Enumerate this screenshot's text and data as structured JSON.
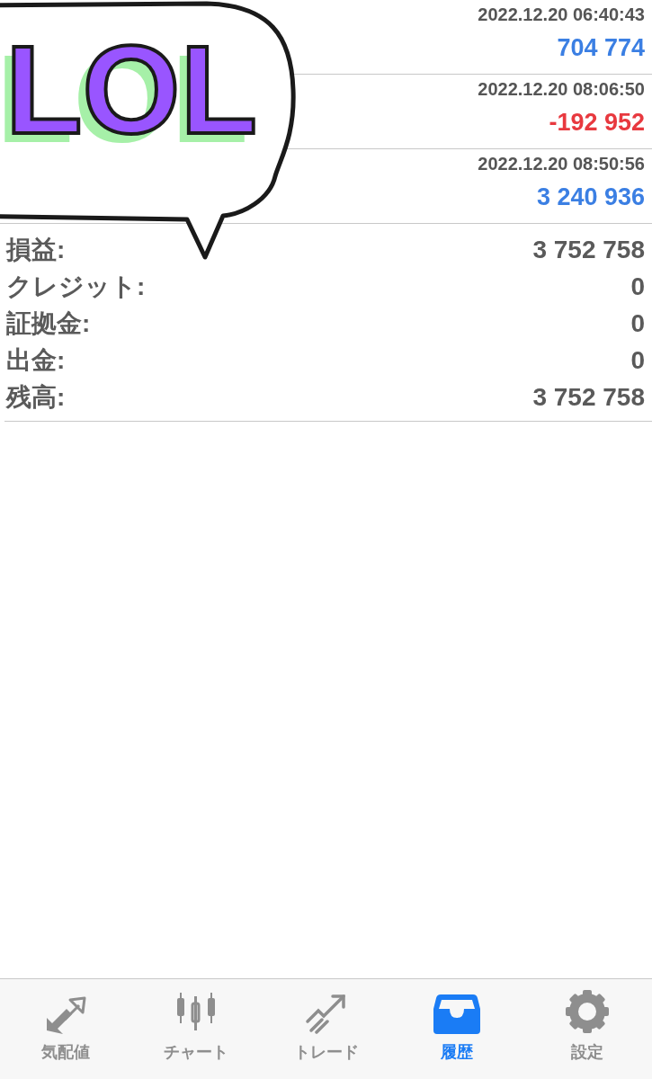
{
  "sticker": {
    "text": "LOL"
  },
  "trades": [
    {
      "time": "2022.12.20 06:40:43",
      "profit": "704 774",
      "kind": "gain"
    },
    {
      "time": "2022.12.20 08:06:50",
      "profit": "-192 952",
      "kind": "loss"
    },
    {
      "time": "2022.12.20 08:50:56",
      "profit": "3 240 936",
      "kind": "gain"
    }
  ],
  "summary": [
    {
      "label": "損益:",
      "value": "3 752 758"
    },
    {
      "label": "クレジット:",
      "value": "0"
    },
    {
      "label": "証拠金:",
      "value": "0"
    },
    {
      "label": "出金:",
      "value": "0"
    },
    {
      "label": "残高:",
      "value": "3 752 758"
    }
  ],
  "tabs": [
    {
      "label": "気配値",
      "selected": false
    },
    {
      "label": "チャート",
      "selected": false
    },
    {
      "label": "トレード",
      "selected": false
    },
    {
      "label": "履歴",
      "selected": true
    },
    {
      "label": "設定",
      "selected": false
    }
  ]
}
